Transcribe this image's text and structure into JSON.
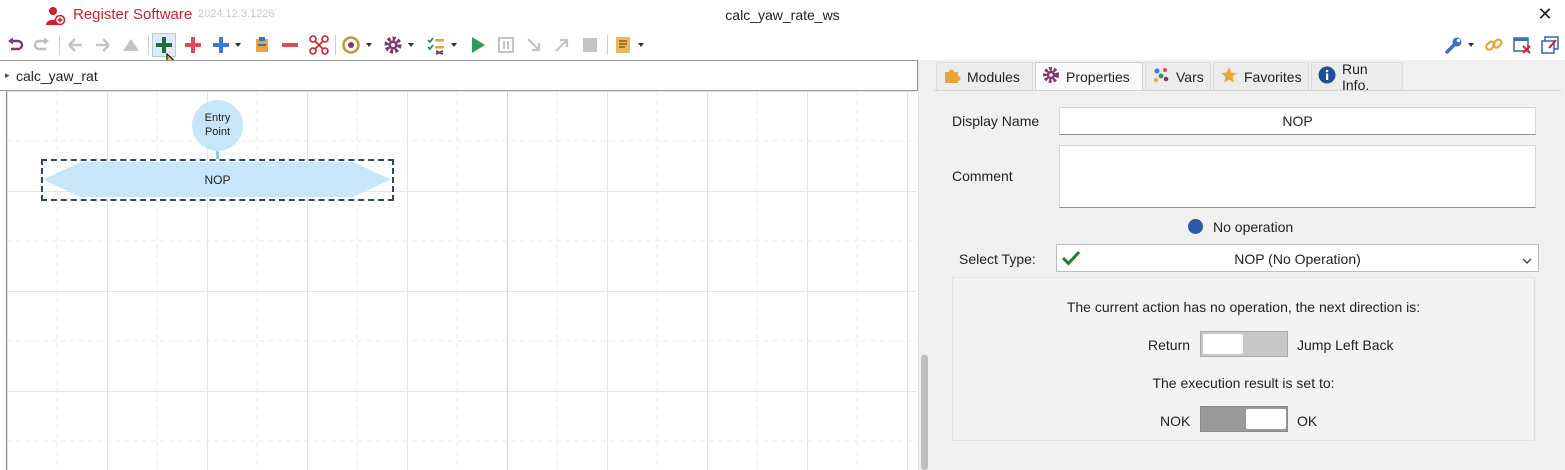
{
  "app": {
    "brand_label": "Register Software",
    "version": "2024.12.3.1226",
    "window_title": "calc_yaw_rate_ws",
    "close_glyph": "✕"
  },
  "toolbar": {
    "items": [
      "undo-icon",
      "redo-icon",
      "back-icon",
      "forward-icon",
      "up-icon",
      "add-green-icon",
      "add-red-icon",
      "add-blue-icon",
      "clipboard-icon",
      "remove-icon",
      "scissors-icon",
      "target-icon",
      "gear-icon",
      "checklist-icon",
      "play-icon",
      "pause-icon",
      "step-in-icon",
      "step-out-icon",
      "stop-icon",
      "script-icon",
      "wrench-icon",
      "link-icon",
      "window-close-icon",
      "window-restore-icon"
    ]
  },
  "breadcrumb": {
    "arrow": "▸",
    "text": "calc_yaw_rat"
  },
  "flow": {
    "entry_line1": "Entry",
    "entry_line2": "Point",
    "node_label": "NOP"
  },
  "tabs": [
    {
      "label": "Modules",
      "icon": "puzzle-icon"
    },
    {
      "label": "Properties",
      "icon": "gear-icon"
    },
    {
      "label": "Vars",
      "icon": "dots-icon"
    },
    {
      "label": "Favorites",
      "icon": "star-icon"
    },
    {
      "label": "Run Info.",
      "icon": "info-icon"
    }
  ],
  "active_tab": "Properties",
  "properties": {
    "display_name_label": "Display Name",
    "display_name_value": "NOP",
    "comment_label": "Comment",
    "comment_value": "",
    "status_text": "No operation",
    "select_type_label": "Select Type:",
    "select_type_value": "NOP (No Operation)",
    "direction_text": "The current action has no operation, the next direction is:",
    "direction_left": "Return",
    "direction_right": "Jump Left Back",
    "direction_state": "Return",
    "result_text": "The execution result is set to:",
    "result_left": "NOK",
    "result_right": "OK",
    "result_state": "OK"
  },
  "colors": {
    "brand_red": "#d0202a",
    "status_blue": "#2b5ba6",
    "node_fill": "#c7e6fa",
    "node_border": "#2e4571",
    "check_green": "#1e7d3c"
  }
}
